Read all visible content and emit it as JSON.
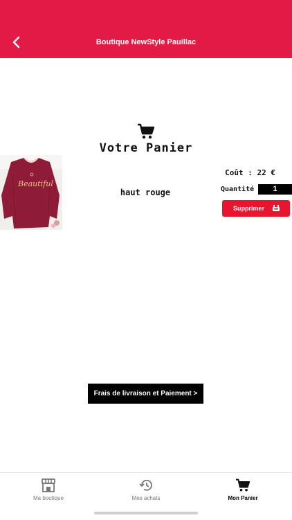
{
  "header": {
    "title": "Boutique NewStyle Pauillac",
    "back_icon": "chevron-left-icon",
    "color": "#e21a45"
  },
  "cart": {
    "title": "Votre Panier",
    "icon": "cart-icon",
    "item": {
      "name": "haut rouge",
      "cost": "Coût : 22 €",
      "quantity_label": "Quantité :",
      "quantity": "1",
      "delete_label": "Supprimer",
      "delete_icon": "trash-icon",
      "image_text": "Beautiful"
    }
  },
  "checkout": {
    "label": "Frais de livraison et Paiement >"
  },
  "tabs": [
    {
      "label": "Ma boutique",
      "icon": "store-icon",
      "active": false
    },
    {
      "label": "Mes achats",
      "icon": "history-icon",
      "active": false
    },
    {
      "label": "Mon Panier",
      "icon": "cart-icon",
      "active": true
    }
  ],
  "colors": {
    "accent": "#e21a45",
    "delete": "#e8152f"
  }
}
